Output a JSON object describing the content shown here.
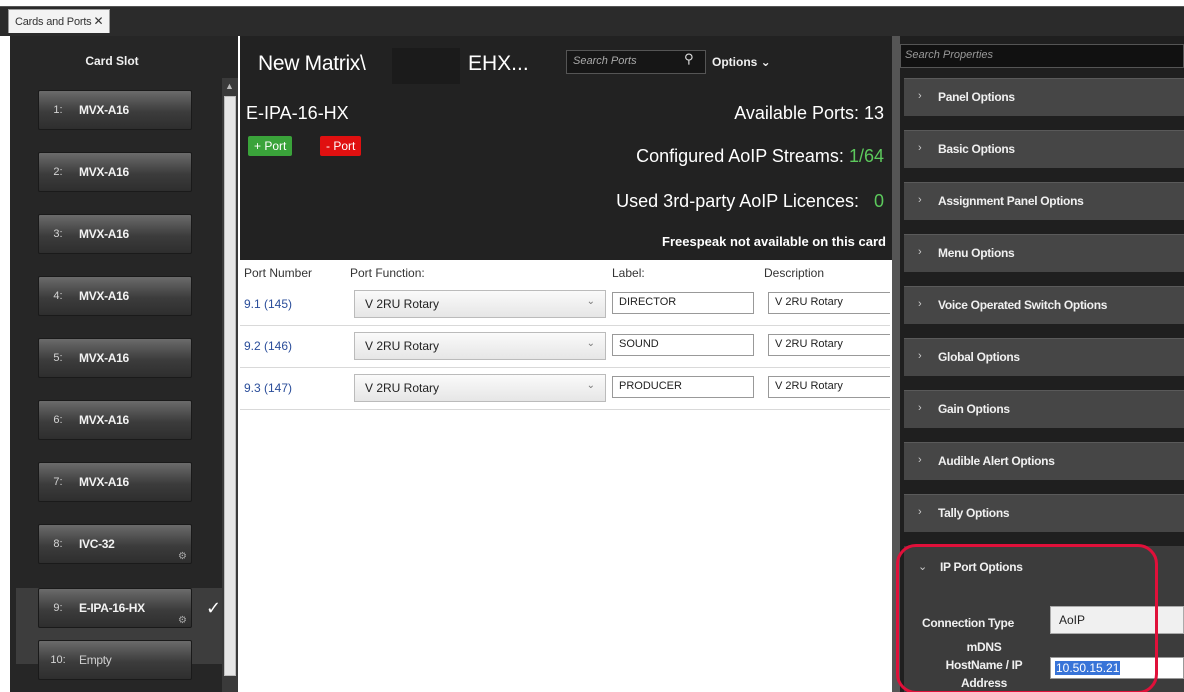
{
  "tab": {
    "label": "Cards and Ports",
    "close": "✕"
  },
  "left": {
    "title": "Card Slot",
    "slots": [
      {
        "num": "1:",
        "name": "MVX-A16"
      },
      {
        "num": "2:",
        "name": "MVX-A16"
      },
      {
        "num": "3:",
        "name": "MVX-A16"
      },
      {
        "num": "4:",
        "name": "MVX-A16"
      },
      {
        "num": "5:",
        "name": "MVX-A16"
      },
      {
        "num": "6:",
        "name": "MVX-A16"
      },
      {
        "num": "7:",
        "name": "MVX-A16"
      },
      {
        "num": "8:",
        "name": "IVC-32"
      },
      {
        "num": "9:",
        "name": "E-IPA-16-HX"
      },
      {
        "num": "10:",
        "name": "Empty"
      }
    ]
  },
  "center": {
    "title": "New Matrix\\",
    "title_suffix": "EHX...",
    "search_placeholder": "Search Ports",
    "options": "Options",
    "card_name": "E-IPA-16-HX",
    "available_ports": "Available Ports: 13",
    "add_port": "+ Port",
    "remove_port": "- Port",
    "streams_label": "Configured AoIP Streams:",
    "streams_value": "1/64",
    "licences_label": "Used 3rd-party AoIP Licences:",
    "licences_value": "0",
    "freespeak": "Freespeak not available on this card",
    "columns": {
      "port_number": "Port Number",
      "port_function": "Port Function:",
      "label": "Label:",
      "description": "Description"
    },
    "ports": [
      {
        "number": "9.1 (145)",
        "function": "V 2RU Rotary",
        "label": "DIRECTOR",
        "description": "V 2RU Rotary"
      },
      {
        "number": "9.2 (146)",
        "function": "V 2RU Rotary",
        "label": "SOUND",
        "description": "V 2RU Rotary"
      },
      {
        "number": "9.3 (147)",
        "function": "V 2RU Rotary",
        "label": "PRODUCER",
        "description": "V 2RU Rotary"
      }
    ]
  },
  "right": {
    "search_placeholder": "Search Properties",
    "sections": [
      "Panel Options",
      "Basic Options",
      "Assignment Panel Options",
      "Menu Options",
      "Voice Operated Switch Options",
      "Global Options",
      "Gain Options",
      "Audible Alert Options",
      "Tally Options"
    ],
    "ip_section": {
      "title": "IP Port Options",
      "connection_type_label": "Connection Type",
      "connection_type_value": "AoIP",
      "mdns_label_1": "mDNS",
      "mdns_label_2": "HostName / IP",
      "mdns_label_3": "Address",
      "mdns_value": "10.50.15.21"
    }
  },
  "colors": {
    "highlight": "#e0103a",
    "add": "#3aa33a",
    "remove": "#e01010",
    "accent_value": "#5cc95c"
  }
}
